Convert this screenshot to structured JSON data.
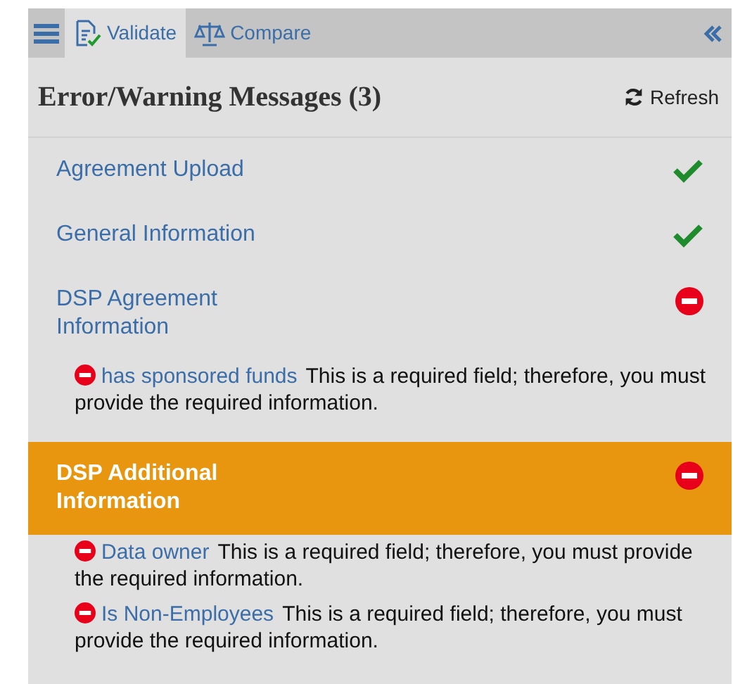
{
  "toolbar": {
    "tabs": [
      {
        "label": "Validate",
        "kind": "validate",
        "selected": true
      },
      {
        "label": "Compare",
        "kind": "compare",
        "selected": false
      }
    ]
  },
  "header": {
    "title": "Error/Warning Messages (3)",
    "refresh": "Refresh"
  },
  "sections": [
    {
      "title": "Agreement Upload",
      "kind": "ok",
      "selected": false
    },
    {
      "title": "General Information",
      "kind": "ok",
      "selected": false
    },
    {
      "title": "DSP Agreement Information",
      "kind": "error",
      "selected": false,
      "messages": [
        {
          "field": "has sponsored funds",
          "text": "This is a required field; therefore, you must provide the required information."
        }
      ]
    },
    {
      "title": "DSP Additional Information",
      "kind": "error",
      "selected": true,
      "messages": [
        {
          "field": "Data owner",
          "text": "This is a required field; therefore, you must provide the required information."
        },
        {
          "field": "Is Non-Employees",
          "text": "This is a required field; therefore, you must provide the required information."
        }
      ]
    }
  ]
}
